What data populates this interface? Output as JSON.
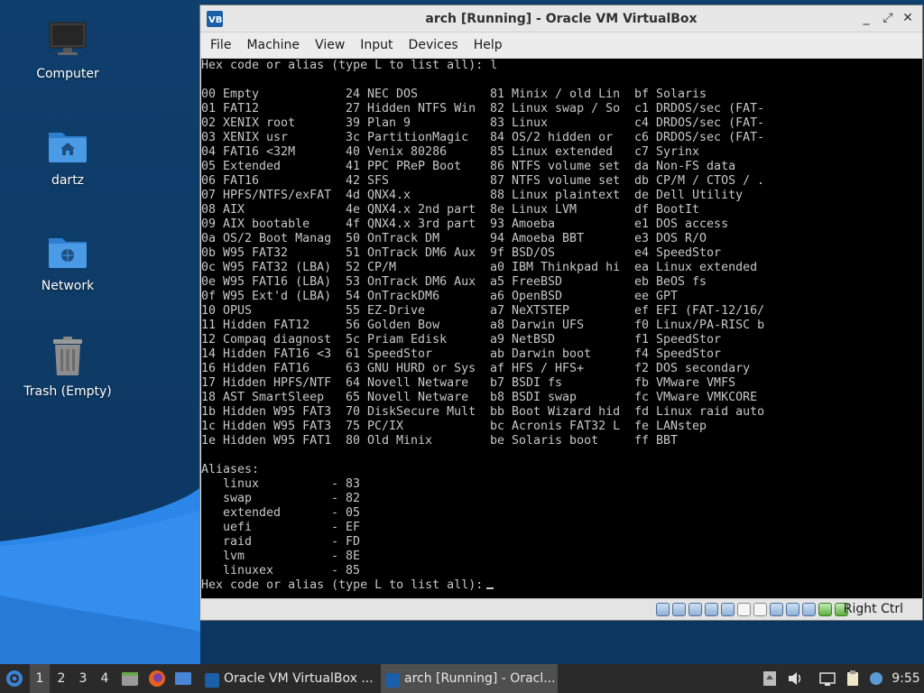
{
  "desktop": {
    "icons": [
      {
        "label": "Computer",
        "icon": "monitor-icon"
      },
      {
        "label": "dartz",
        "icon": "home-folder-icon"
      },
      {
        "label": "Network",
        "icon": "network-folder-icon"
      },
      {
        "label": "Trash (Empty)",
        "icon": "trash-icon"
      }
    ]
  },
  "window": {
    "title": "arch [Running] - Oracle VM VirtualBox",
    "menu": [
      "File",
      "Machine",
      "View",
      "Input",
      "Devices",
      "Help"
    ],
    "controls": {
      "minimize": "_",
      "restore": "⤢",
      "close": "✕"
    }
  },
  "terminal": {
    "prompt_top": "Hex code or alias (type L to list all): l",
    "partition_rows": [
      [
        "00 Empty",
        "24 NEC DOS",
        "81 Minix / old Lin",
        "bf Solaris"
      ],
      [
        "01 FAT12",
        "27 Hidden NTFS Win",
        "82 Linux swap / So",
        "c1 DRDOS/sec (FAT-"
      ],
      [
        "02 XENIX root",
        "39 Plan 9",
        "83 Linux",
        "c4 DRDOS/sec (FAT-"
      ],
      [
        "03 XENIX usr",
        "3c PartitionMagic",
        "84 OS/2 hidden or",
        "c6 DRDOS/sec (FAT-"
      ],
      [
        "04 FAT16 <32M",
        "40 Venix 80286",
        "85 Linux extended",
        "c7 Syrinx"
      ],
      [
        "05 Extended",
        "41 PPC PReP Boot",
        "86 NTFS volume set",
        "da Non-FS data"
      ],
      [
        "06 FAT16",
        "42 SFS",
        "87 NTFS volume set",
        "db CP/M / CTOS / ."
      ],
      [
        "07 HPFS/NTFS/exFAT",
        "4d QNX4.x",
        "88 Linux plaintext",
        "de Dell Utility"
      ],
      [
        "08 AIX",
        "4e QNX4.x 2nd part",
        "8e Linux LVM",
        "df BootIt"
      ],
      [
        "09 AIX bootable",
        "4f QNX4.x 3rd part",
        "93 Amoeba",
        "e1 DOS access"
      ],
      [
        "0a OS/2 Boot Manag",
        "50 OnTrack DM",
        "94 Amoeba BBT",
        "e3 DOS R/O"
      ],
      [
        "0b W95 FAT32",
        "51 OnTrack DM6 Aux",
        "9f BSD/OS",
        "e4 SpeedStor"
      ],
      [
        "0c W95 FAT32 (LBA)",
        "52 CP/M",
        "a0 IBM Thinkpad hi",
        "ea Linux extended"
      ],
      [
        "0e W95 FAT16 (LBA)",
        "53 OnTrack DM6 Aux",
        "a5 FreeBSD",
        "eb BeOS fs"
      ],
      [
        "0f W95 Ext'd (LBA)",
        "54 OnTrackDM6",
        "a6 OpenBSD",
        "ee GPT"
      ],
      [
        "10 OPUS",
        "55 EZ-Drive",
        "a7 NeXTSTEP",
        "ef EFI (FAT-12/16/"
      ],
      [
        "11 Hidden FAT12",
        "56 Golden Bow",
        "a8 Darwin UFS",
        "f0 Linux/PA-RISC b"
      ],
      [
        "12 Compaq diagnost",
        "5c Priam Edisk",
        "a9 NetBSD",
        "f1 SpeedStor"
      ],
      [
        "14 Hidden FAT16 <3",
        "61 SpeedStor",
        "ab Darwin boot",
        "f4 SpeedStor"
      ],
      [
        "16 Hidden FAT16",
        "63 GNU HURD or Sys",
        "af HFS / HFS+",
        "f2 DOS secondary"
      ],
      [
        "17 Hidden HPFS/NTF",
        "64 Novell Netware",
        "b7 BSDI fs",
        "fb VMware VMFS"
      ],
      [
        "18 AST SmartSleep",
        "65 Novell Netware",
        "b8 BSDI swap",
        "fc VMware VMKCORE"
      ],
      [
        "1b Hidden W95 FAT3",
        "70 DiskSecure Mult",
        "bb Boot Wizard hid",
        "fd Linux raid auto"
      ],
      [
        "1c Hidden W95 FAT3",
        "75 PC/IX",
        "bc Acronis FAT32 L",
        "fe LANstep"
      ],
      [
        "1e Hidden W95 FAT1",
        "80 Old Minix",
        "be Solaris boot",
        "ff BBT"
      ]
    ],
    "aliases_header": "Aliases:",
    "aliases": [
      {
        "name": "linux",
        "code": "83"
      },
      {
        "name": "swap",
        "code": "82"
      },
      {
        "name": "extended",
        "code": "05"
      },
      {
        "name": "uefi",
        "code": "EF"
      },
      {
        "name": "raid",
        "code": "FD"
      },
      {
        "name": "lvm",
        "code": "8E"
      },
      {
        "name": "linuxex",
        "code": "85"
      }
    ],
    "prompt_bottom": "Hex code or alias (type L to list all):"
  },
  "statusbar": {
    "host_key": "Right Ctrl"
  },
  "taskbar": {
    "workspaces": [
      "1",
      "2",
      "3",
      "4"
    ],
    "active_workspace": "1",
    "tasks": [
      {
        "label": "Oracle VM VirtualBox ...",
        "active": false
      },
      {
        "label": "arch [Running] - Oracl...",
        "active": true
      }
    ],
    "clock": "9:55"
  },
  "colors": {
    "desktop_bg": "#0e3a66",
    "wave": "#2b86e8",
    "terminal_bg": "#000000",
    "terminal_fg": "#c8c8c8",
    "taskbar_bg": "#2a2a2a"
  }
}
